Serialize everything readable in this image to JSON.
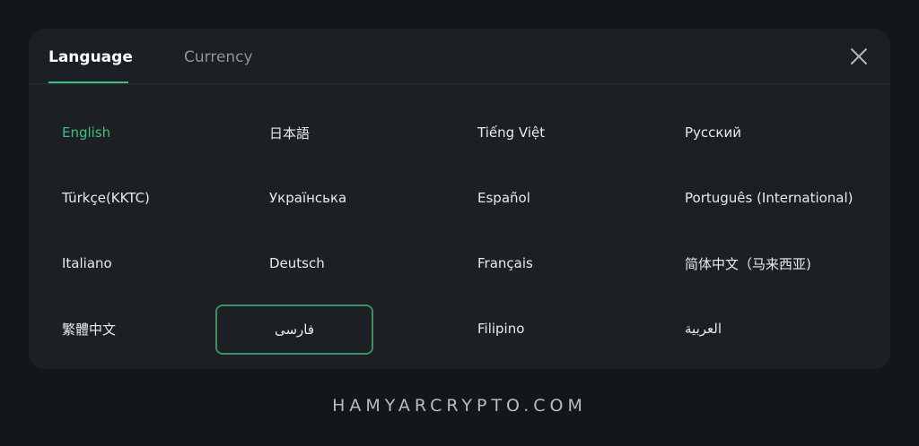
{
  "tabs": {
    "language": "Language",
    "currency": "Currency"
  },
  "languages": [
    "English",
    "日本語",
    "Tiếng Việt",
    "Русский",
    "Türkçe(KKTC)",
    "Українська",
    "Español",
    "Português (International)",
    "Italiano",
    "Deutsch",
    "Français",
    "简体中文（马来西亚)",
    "繁體中文",
    "فارسی",
    "Filipino",
    "العربية"
  ],
  "selected_language": "English",
  "highlighted_language": "فارسی",
  "footer_watermark": "HAMYARCRYPTO.COM",
  "colors": {
    "background": "#13161b",
    "modal": "#1c1f24",
    "accent_green": "#3fbf7f",
    "highlight_border": "#3f8f62",
    "text": "#e8eaed",
    "muted": "#8e949c"
  },
  "icons": {
    "close": "close-icon"
  }
}
